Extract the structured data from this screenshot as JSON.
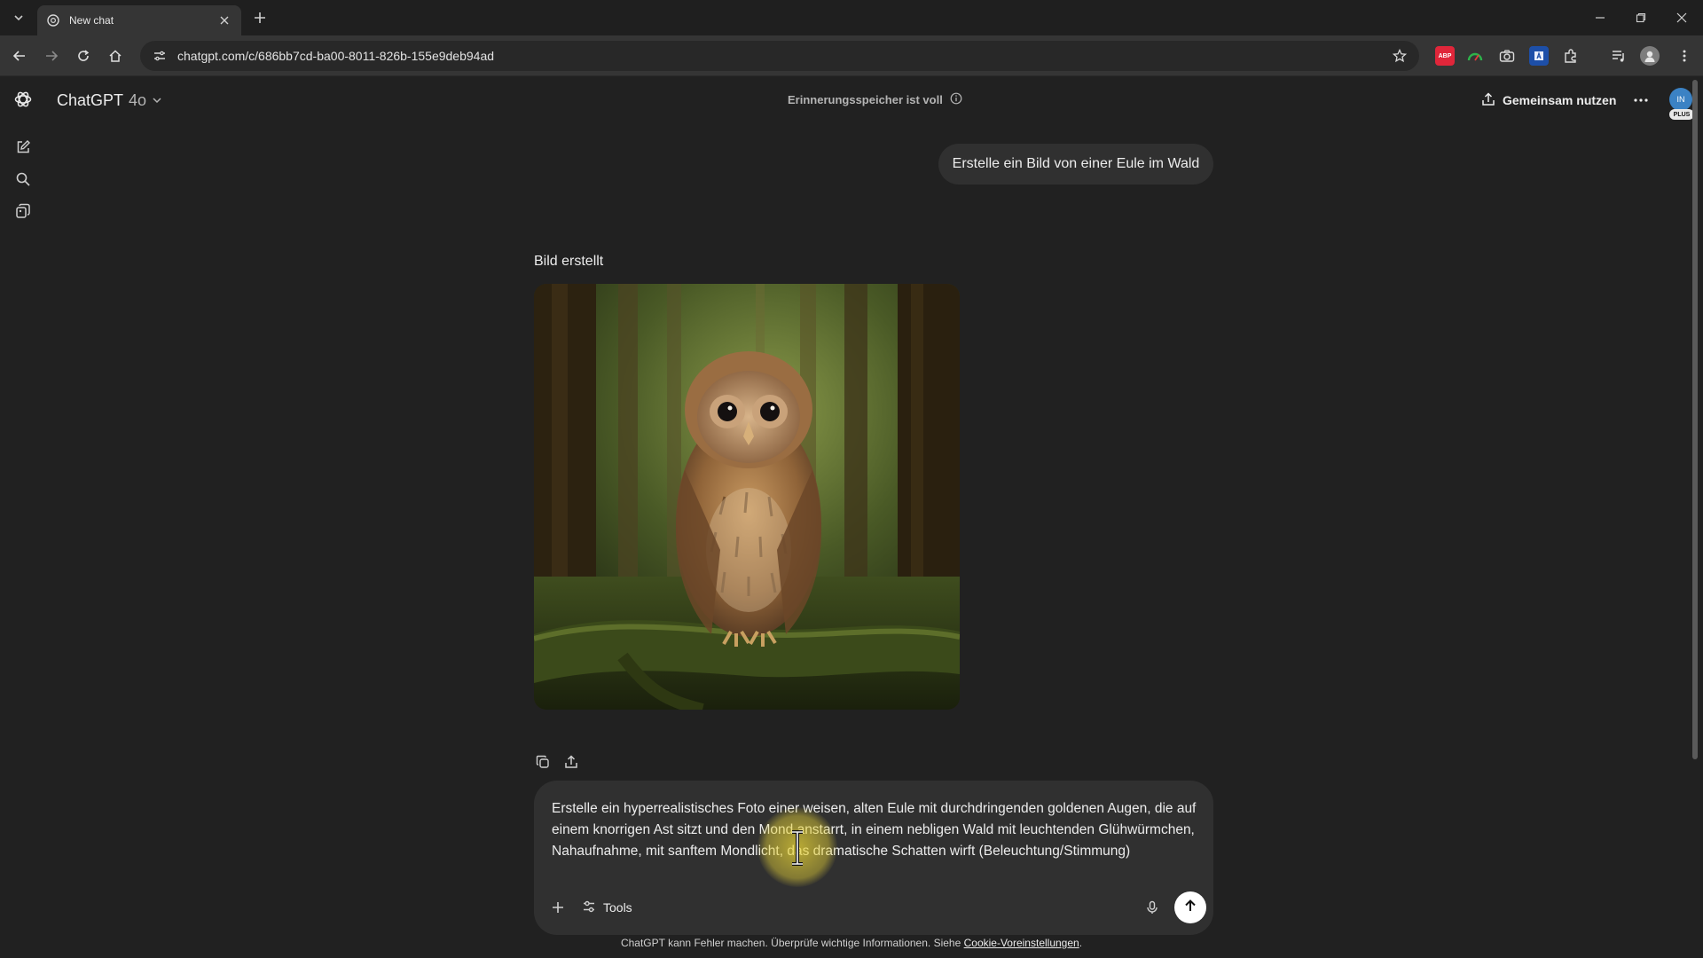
{
  "browser": {
    "tab_title": "New chat",
    "url": "chatgpt.com/c/686bb7cd-ba00-8011-826b-155e9deb94ad"
  },
  "extensions": {
    "abp_label": "ABP"
  },
  "header": {
    "model_name": "ChatGPT",
    "model_version": "4o",
    "memory_notice": "Erinnerungsspeicher ist voll",
    "share_label": "Gemeinsam nutzen",
    "avatar_initials": "IN",
    "plan_badge": "PLUS"
  },
  "conversation": {
    "user_message": "Erstelle ein Bild von einer Eule im Wald",
    "image_status": "Bild erstellt"
  },
  "composer": {
    "prompt_text": "Erstelle ein hyperrealistisches Foto einer weisen, alten Eule mit durchdringenden goldenen Augen, die auf einem knorrigen Ast sitzt und den Mond anstarrt, in einem nebligen Wald mit leuchtenden Glühwürmchen, Nahaufnahme, mit sanftem Mondlicht, das dramatische Schatten wirft (Beleuchtung/Stimmung)",
    "tools_label": "Tools"
  },
  "footer": {
    "disclaimer": "ChatGPT kann Fehler machen. Überprüfe wichtige Informationen. Siehe ",
    "link_text": "Cookie-Voreinstellungen",
    "period": "."
  },
  "colors": {
    "background": "#212121",
    "bubble": "#303030",
    "text": "#ececec",
    "muted_text": "#b4b4b4",
    "cursor_highlight": "#e8d437"
  }
}
